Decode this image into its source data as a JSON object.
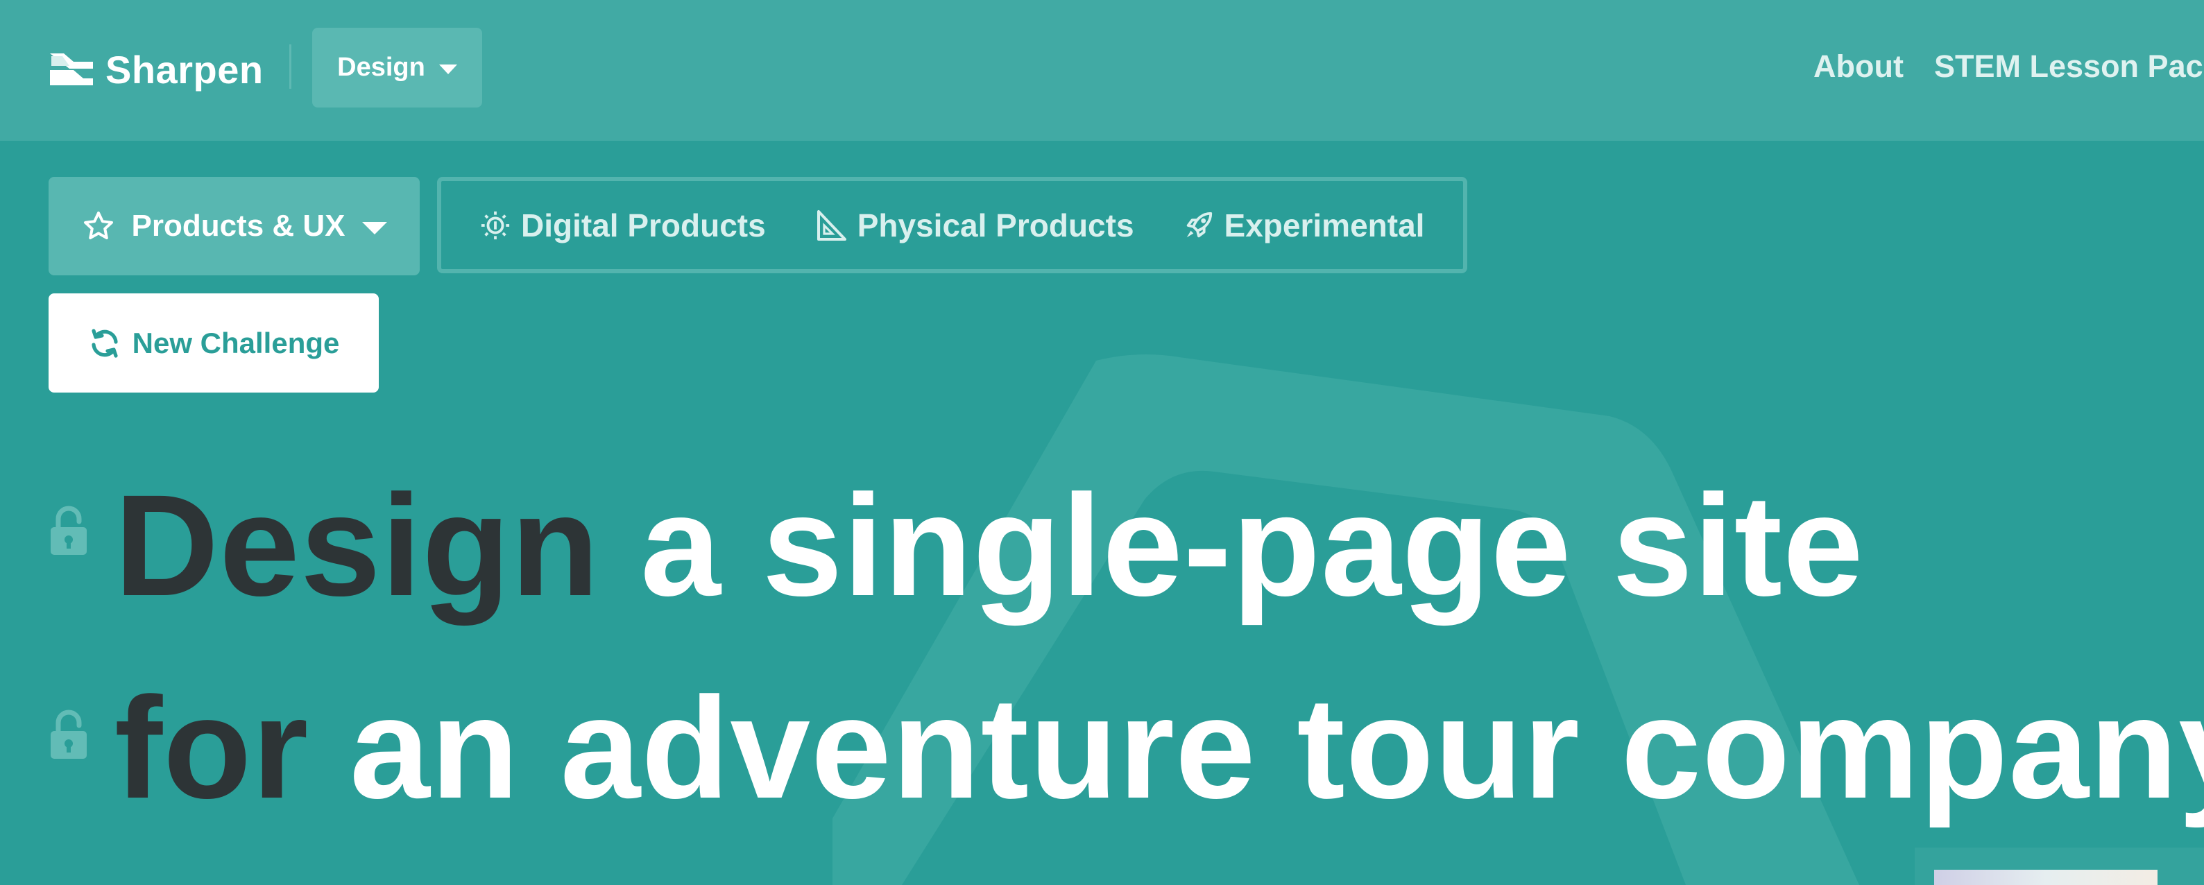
{
  "brand": {
    "name": "Sharpen",
    "icon": "sharpen-logo-icon"
  },
  "header": {
    "mode_dropdown": "Design",
    "nav": {
      "about": "About",
      "stem": "STEM Lesson Pack"
    }
  },
  "filters": {
    "category_dropdown": {
      "label": "Products & UX",
      "icon": "star-icon"
    },
    "subcategories": [
      {
        "label": "Digital Products",
        "icon": "lightbulb-icon"
      },
      {
        "label": "Physical Products",
        "icon": "set-square-icon"
      },
      {
        "label": "Experimental",
        "icon": "rocket-icon"
      }
    ]
  },
  "actions": {
    "new_challenge": "New Challenge"
  },
  "challenge": {
    "line1": {
      "keyword": "Design",
      "text": "a single-page site"
    },
    "line2": {
      "keyword": "for",
      "text": "an adventure tour company"
    }
  },
  "colors": {
    "background": "#2a9e98",
    "header": "#41aaa4",
    "keyword": "#2d3436",
    "white": "#ffffff"
  }
}
